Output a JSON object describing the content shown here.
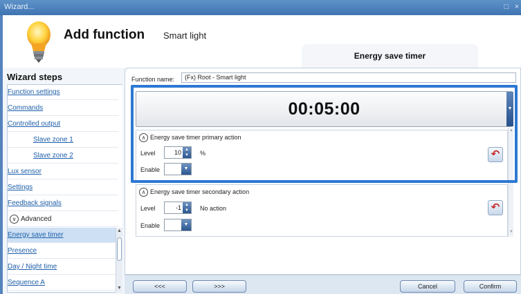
{
  "window": {
    "title": "Wizard..."
  },
  "header": {
    "title": "Add function",
    "subtitle": "Smart light",
    "active_tab": "Energy save timer"
  },
  "sidebar": {
    "title": "Wizard steps",
    "items": [
      {
        "label": "Function settings"
      },
      {
        "label": "Commands"
      },
      {
        "label": "Controlled output"
      },
      {
        "label": "Slave zone 1"
      },
      {
        "label": "Slave zone 2"
      },
      {
        "label": "Lux sensor"
      },
      {
        "label": "Settings"
      },
      {
        "label": "Feedback signals"
      },
      {
        "label": "Advanced"
      },
      {
        "label": "Energy save timer"
      },
      {
        "label": "Presence"
      },
      {
        "label": "Day / Night time"
      },
      {
        "label": "Sequence A"
      }
    ]
  },
  "form": {
    "function_name_label": "Function name:",
    "function_name_value": "(Fx) Root - Smart light",
    "timer_value": "00:05:00",
    "primary": {
      "title": "Energy save timer primary action",
      "level_label": "Level",
      "level_value": "10",
      "unit": "%",
      "enable_label": "Enable"
    },
    "secondary": {
      "title": "Energy save timer secondary action",
      "level_label": "Level",
      "level_value": "-1",
      "unit": "No action",
      "enable_label": "Enable"
    }
  },
  "footer": {
    "prev": "<<<",
    "next": ">>>",
    "cancel": "Cancel",
    "confirm": "Confirm"
  },
  "colors": {
    "accent": "#2c78d3",
    "titlebar": "#4a7fbf",
    "link": "#1f5faa"
  }
}
